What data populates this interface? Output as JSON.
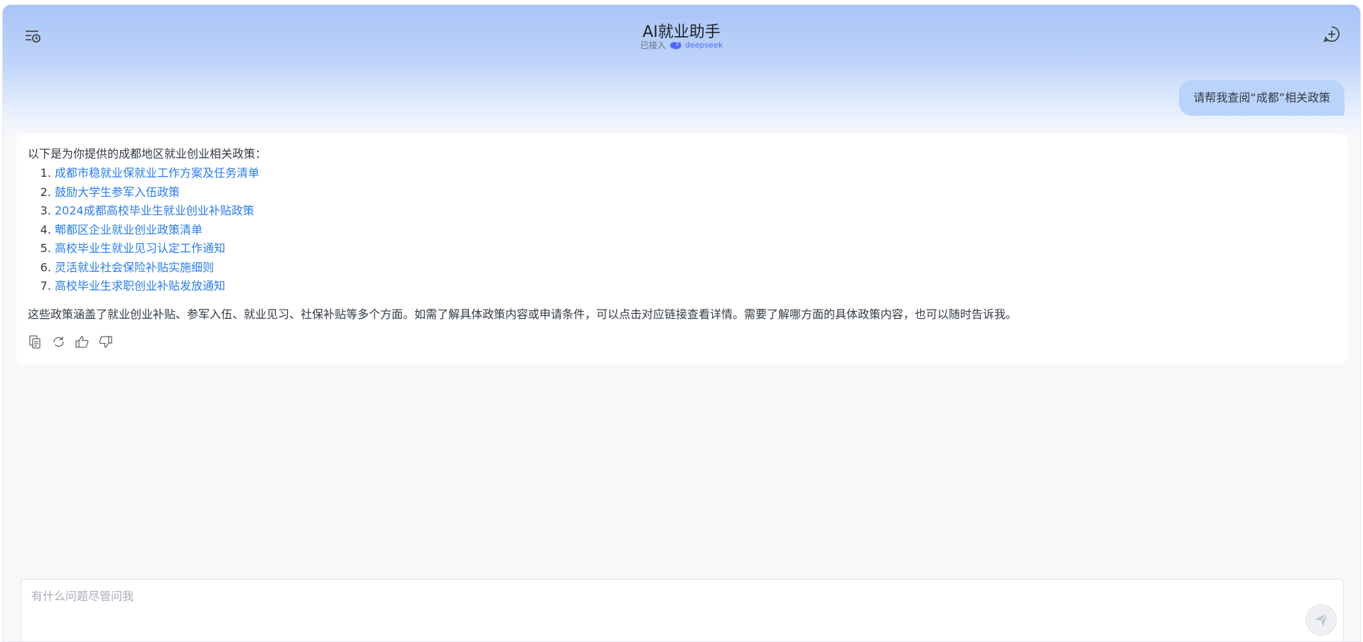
{
  "header": {
    "title": "AI就业助手",
    "connected_label": "已接入",
    "brand_name": "deepseek",
    "brand_color": "#4d6bfe",
    "menu_icon": "history-menu-icon",
    "new_chat_icon": "plus-circle-icon"
  },
  "user_message": "请帮我查阅“成都”相关政策",
  "answer": {
    "intro": "以下是为你提供的成都地区就业创业相关政策：",
    "policies": [
      "成都市稳就业保就业工作方案及任务清单",
      "鼓励大学生参军入伍政策",
      "2024成都高校毕业生就业创业补贴政策",
      "郫都区企业就业创业政策清单",
      "高校毕业生就业见习认定工作通知",
      "灵活就业社会保险补贴实施细则",
      "高校毕业生求职创业补贴发放通知"
    ],
    "summary": "这些政策涵盖了就业创业补贴、参军入伍、就业见习、社保补贴等多个方面。如需了解具体政策内容或申请条件，可以点击对应链接查看详情。需要了解哪方面的具体政策内容，也可以随时告诉我。",
    "actions": [
      "copy-icon",
      "refresh-icon",
      "thumbs-up-icon",
      "thumbs-down-icon"
    ]
  },
  "input": {
    "placeholder": "有什么问题尽管问我",
    "value": ""
  },
  "colors": {
    "link": "#2b7de6",
    "user_bubble": "#bad3fb",
    "header_gradient_top": "#a8c4f7"
  }
}
